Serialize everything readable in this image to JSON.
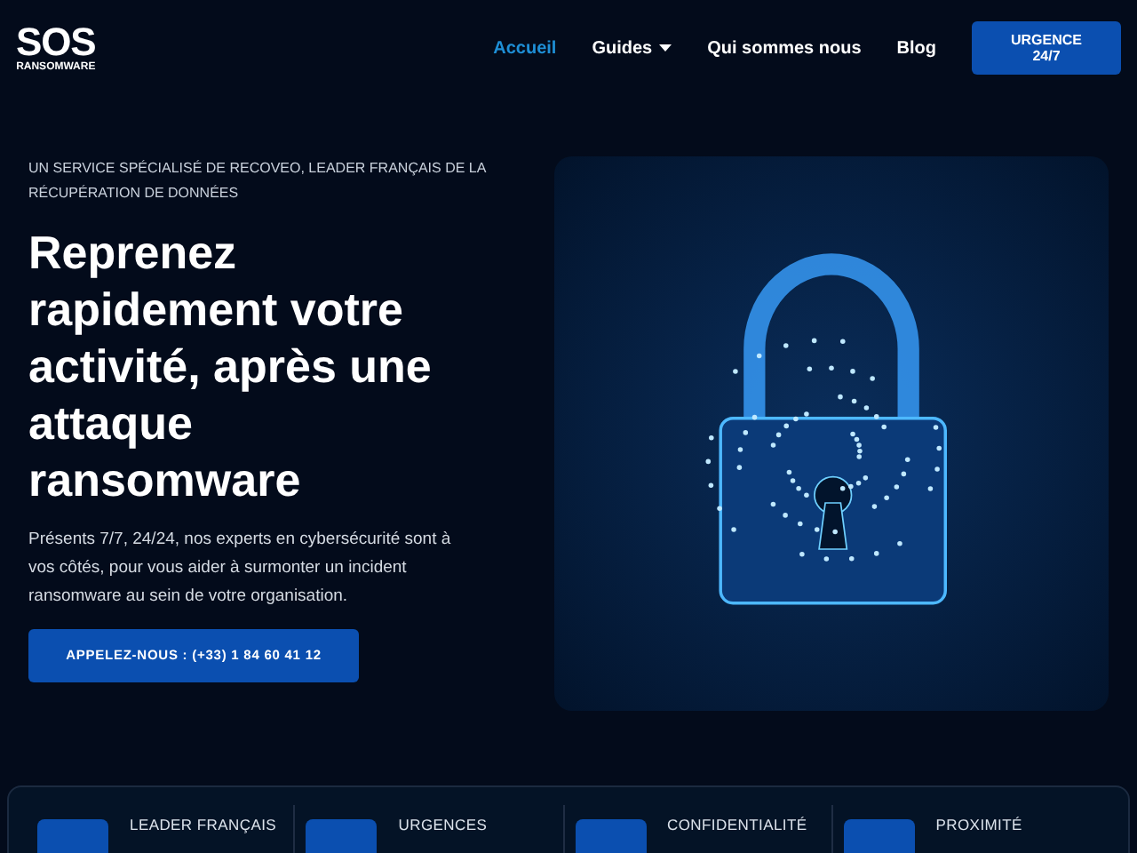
{
  "logo": {
    "title": "SOS",
    "subtitle": "RANSOMWARE"
  },
  "nav": [
    {
      "label": "Accueil",
      "selected": true,
      "dropdown": false
    },
    {
      "label": "Guides",
      "selected": false,
      "dropdown": true
    },
    {
      "label": "Qui sommes nous",
      "selected": false,
      "dropdown": false
    },
    {
      "label": "Blog",
      "selected": false,
      "dropdown": false
    }
  ],
  "cta": [
    "URGENCE",
    "24/7"
  ],
  "hero": {
    "eyebrow": "UN SERVICE SPÉCIALISÉ DE RECOVEO, LEADER FRANÇAIS DE LA RÉCUPÉRATION DE DONNÉES",
    "title": "Reprenez rapidement votre activité, après une attaque ransomware",
    "text": "Présents 7/7, 24/24, nos experts en cybersécurité sont à vos côtés, pour vous aider à surmonter un incident ransomware au sein de votre organisation.",
    "button": "APPELEZ-NOUS : (+33) 1 84 60 41 12"
  },
  "features": [
    {
      "title": "LEADER FRANÇAIS"
    },
    {
      "title": "URGENCES"
    },
    {
      "title": "CONFIDENTIALITÉ"
    },
    {
      "title": "PROXIMITÉ"
    }
  ]
}
